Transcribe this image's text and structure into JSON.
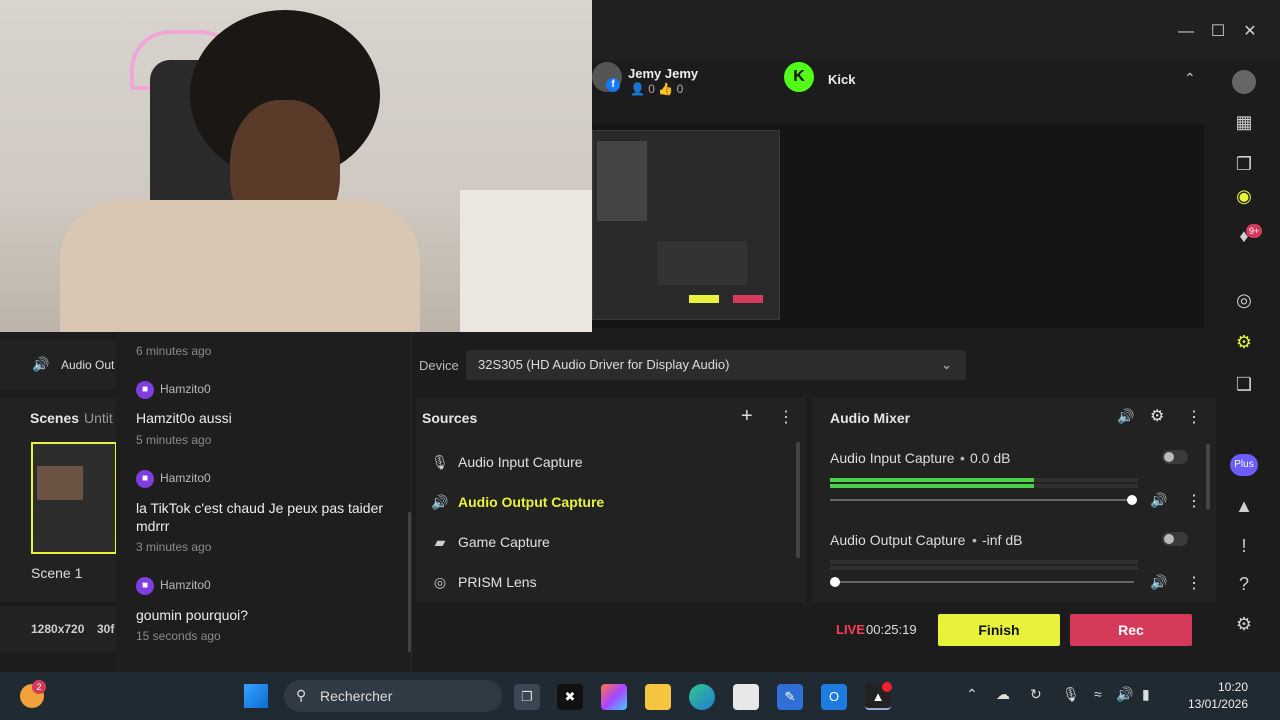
{
  "window": {
    "minimize": "—",
    "maximize": "☐",
    "close": "✕"
  },
  "channels": [
    {
      "name": "Jemy Jemy",
      "viewers": "0",
      "likes": "0",
      "platform": "facebook"
    },
    {
      "name": "Kick",
      "platform": "kick"
    }
  ],
  "audio_strip": {
    "label": "Audio Out"
  },
  "scenes": {
    "title": "Scenes",
    "collection": "Untit",
    "items": [
      {
        "label": "Scene 1"
      }
    ]
  },
  "status": {
    "resolution": "1280x720",
    "fps": "30f"
  },
  "chat": {
    "messages": [
      {
        "user": "",
        "text": "",
        "time": "6 minutes ago"
      },
      {
        "user": "Hamzito0",
        "text": "Hamzit0o aussi",
        "time": "5 minutes ago"
      },
      {
        "user": "Hamzito0",
        "text": "la TikTok c'est chaud Je peux pas taider mdrrr",
        "time": "3 minutes ago"
      },
      {
        "user": "Hamzito0",
        "text": "goumin pourquoi?",
        "time": "15 seconds ago"
      }
    ]
  },
  "device": {
    "label": "Device",
    "value": "32S305 (HD Audio Driver for Display Audio)"
  },
  "sources": {
    "title": "Sources",
    "items": [
      {
        "label": "Audio Input Capture",
        "icon": "microphone-icon",
        "active": false
      },
      {
        "label": "Audio Output Capture",
        "icon": "speaker-icon",
        "active": true
      },
      {
        "label": "Game Capture",
        "icon": "gamepad-icon",
        "active": false
      },
      {
        "label": "PRISM Lens",
        "icon": "lens-icon",
        "active": false
      }
    ]
  },
  "mixer": {
    "title": "Audio Mixer",
    "channels": [
      {
        "name": "Audio Input Capture",
        "level": "0.0 dB",
        "volume": 1.0
      },
      {
        "name": "Audio Output Capture",
        "level": "-inf dB",
        "volume": 0.0
      }
    ]
  },
  "live": {
    "label": "LIVE",
    "time": "00:25:19"
  },
  "buttons": {
    "finish": "Finish",
    "rec": "Rec"
  },
  "rail": {
    "notif_badge": "9+",
    "plus_label": "Plus"
  },
  "taskbar": {
    "search_placeholder": "Rechercher",
    "time": "10:20",
    "date": "13/01/2026",
    "badge": "2"
  },
  "colors": {
    "accent_yellow": "#e9f23a",
    "rec_red": "#d63a5a",
    "live_red": "#ff3d5a",
    "meter_green": "#4cd04a"
  }
}
